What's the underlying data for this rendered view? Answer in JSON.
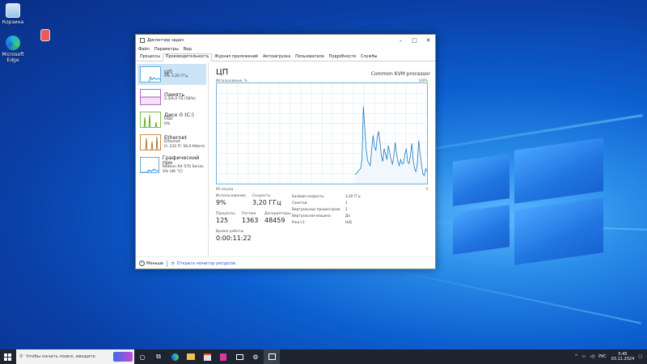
{
  "desktop": {
    "icons": [
      {
        "name": "recycle-bin",
        "label": "Корзина"
      },
      {
        "name": "edge",
        "label": "Microsoft Edge"
      },
      {
        "name": "file",
        "label": ""
      }
    ]
  },
  "window": {
    "title": "Диспетчер задач",
    "menu": [
      "Файл",
      "Параметры",
      "Вид"
    ],
    "tabs": [
      "Процессы",
      "Производительность",
      "Журнал приложений",
      "Автозагрузка",
      "Пользователи",
      "Подробности",
      "Службы"
    ],
    "active_tab": 1,
    "sidebar": [
      {
        "name": "ЦП",
        "sub": "9% 3,20 ГГц",
        "color": "#1b79c4"
      },
      {
        "name": "Память",
        "sub": "2,3/4,0 ГБ (58%)",
        "color": "#8b1fa8"
      },
      {
        "name": "Диск 0 (C:)",
        "sub": "HDD",
        "sub2": "6%",
        "color": "#4d9a0a"
      },
      {
        "name": "Ethernet",
        "sub": "Ethernet",
        "sub2": "О: 232 П: 56,0 Кбит/с",
        "color": "#a75b07"
      },
      {
        "name": "Графический про",
        "sub": "Radeon RX 570 Series",
        "sub2": "3% (46 °C)",
        "color": "#1b79c4"
      }
    ],
    "heading": "ЦП",
    "cpu_model": "Common KVM processor",
    "graph_top_left": "Использование, %",
    "graph_top_right": "100%",
    "graph_bottom_left": "60 секунд",
    "graph_bottom_right": "0",
    "cpu_usage_history": [
      0,
      0,
      0,
      0,
      0,
      0,
      0,
      0,
      0,
      0,
      0,
      0,
      0,
      0,
      0,
      0,
      0,
      0,
      0,
      0,
      0,
      0,
      0,
      0,
      0,
      0,
      0,
      0,
      0,
      0,
      0,
      0,
      0,
      0,
      0,
      0,
      0,
      0,
      0,
      0,
      0,
      0,
      0,
      0,
      0,
      0,
      0,
      0,
      0,
      0,
      0,
      0,
      0,
      0,
      0,
      0,
      0,
      0,
      0,
      0,
      0,
      0,
      0,
      0,
      0,
      0,
      0,
      0,
      0,
      0,
      0,
      0,
      0,
      0,
      0,
      0,
      0,
      0,
      0,
      0,
      0,
      0,
      0,
      0,
      0,
      0,
      0,
      0,
      0,
      0,
      0,
      0,
      0,
      0,
      0,
      0,
      0,
      0,
      0,
      0,
      9,
      10,
      12,
      14,
      15,
      24,
      77,
      55,
      35,
      23,
      20,
      18,
      34,
      48,
      37,
      33,
      46,
      52,
      41,
      28,
      22,
      35,
      30,
      24,
      38,
      31,
      24,
      19,
      28,
      41,
      30,
      22,
      18,
      24,
      20,
      20,
      29,
      35,
      22,
      20,
      28,
      40,
      24,
      15,
      12,
      20,
      43,
      30,
      20,
      10,
      8,
      15,
      12
    ],
    "stats": {
      "usage_label": "Использование",
      "usage": "9%",
      "speed_label": "Скорость",
      "speed": "3,20 ГГц",
      "processes_label": "Процессы",
      "processes": "125",
      "threads_label": "Потоки",
      "threads": "1363",
      "handles_label": "Дескрипторы",
      "handles": "48459",
      "uptime_label": "Время работы",
      "uptime": "0:00:11:22"
    },
    "details": [
      {
        "k": "Базовая скорость:",
        "v": "3,20 ГГц"
      },
      {
        "k": "Сокетов:",
        "v": "1"
      },
      {
        "k": "Виртуальных процессоров:",
        "v": "2"
      },
      {
        "k": "Виртуальная машина:",
        "v": "Да"
      },
      {
        "k": "Кэш L1:",
        "v": "Н/Д"
      }
    ],
    "footer_less": "Меньше",
    "footer_link": "Открыть монитор ресурсов"
  },
  "taskbar": {
    "search_placeholder": "Чтобы начать поиск, введите",
    "lang": "РУС",
    "time": "5:45",
    "date": "03.11.2024"
  }
}
